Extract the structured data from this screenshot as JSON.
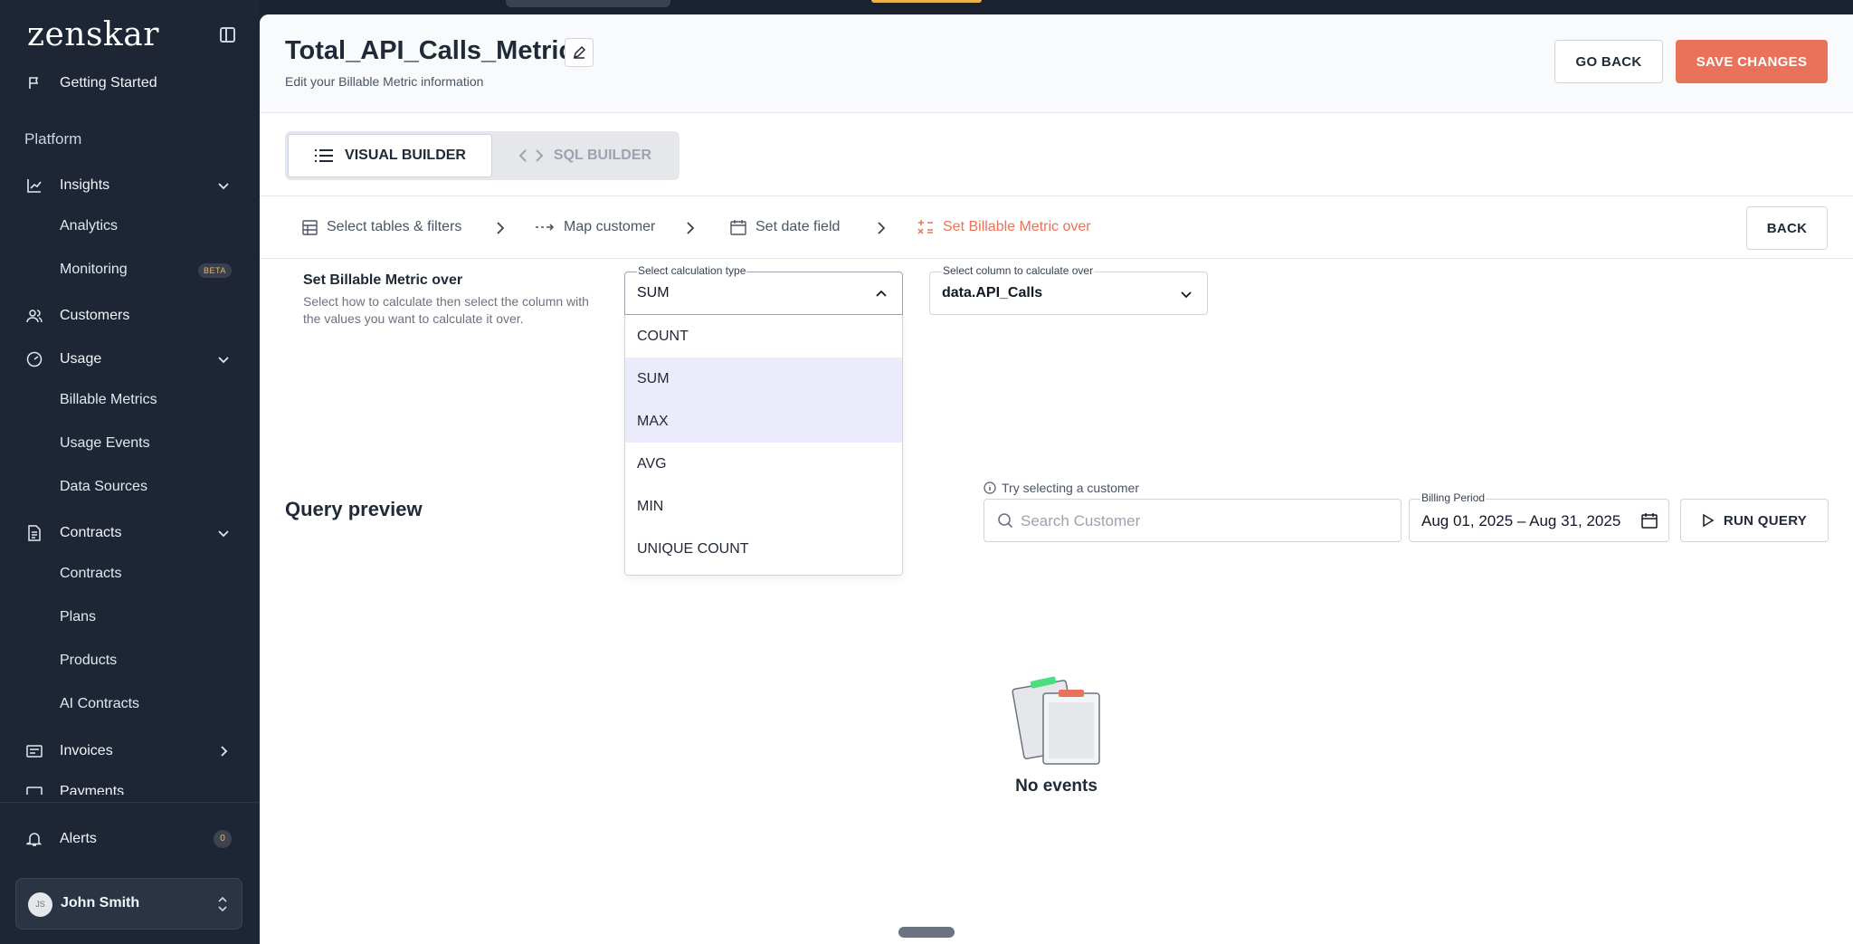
{
  "app": {
    "logo": "zenskar"
  },
  "sidebar": {
    "getting_started": "Getting Started",
    "platform_title": "Platform",
    "insights": "Insights",
    "analytics": "Analytics",
    "monitoring": "Monitoring",
    "beta": "BETA",
    "customers": "Customers",
    "usage": "Usage",
    "billable_metrics": "Billable Metrics",
    "usage_events": "Usage Events",
    "data_sources": "Data Sources",
    "contracts": "Contracts",
    "contracts_sub": "Contracts",
    "plans": "Plans",
    "products": "Products",
    "ai_contracts": "AI Contracts",
    "invoices": "Invoices",
    "payments": "Payments",
    "alerts": "Alerts",
    "alerts_count": "0",
    "user_initials": "JS",
    "user_name": "John Smith"
  },
  "header": {
    "title": "Total_API_Calls_Metric",
    "subtitle": "Edit your Billable Metric information",
    "go_back": "GO BACK",
    "save_changes": "SAVE CHANGES"
  },
  "builder": {
    "visual": "VISUAL BUILDER",
    "sql": "SQL BUILDER"
  },
  "steps": {
    "tables": "Select tables & filters",
    "customer": "Map customer",
    "date": "Set date field",
    "metric": "Set Billable Metric over",
    "back": "BACK"
  },
  "section": {
    "label": "Set Billable Metric over",
    "desc": "Select how to calculate then select the column with the values you want to calculate it over."
  },
  "calc": {
    "label": "Select calculation type",
    "value": "SUM",
    "options": [
      "COUNT",
      "SUM",
      "MAX",
      "AVG",
      "MIN",
      "UNIQUE COUNT"
    ]
  },
  "column": {
    "label": "Select column to calculate over",
    "value": "data.API_Calls"
  },
  "query": {
    "title": "Query preview",
    "hint": "Try selecting a customer",
    "search_placeholder": "Search Customer",
    "period_label": "Billing Period",
    "period_start": "Aug 01, 2025",
    "period_end": "Aug 31, 2025",
    "run": "RUN QUERY",
    "empty": "No events"
  },
  "colors": {
    "accent": "#e8735a",
    "sidebar": "#1e2636",
    "highlight": "#ebebfb"
  }
}
